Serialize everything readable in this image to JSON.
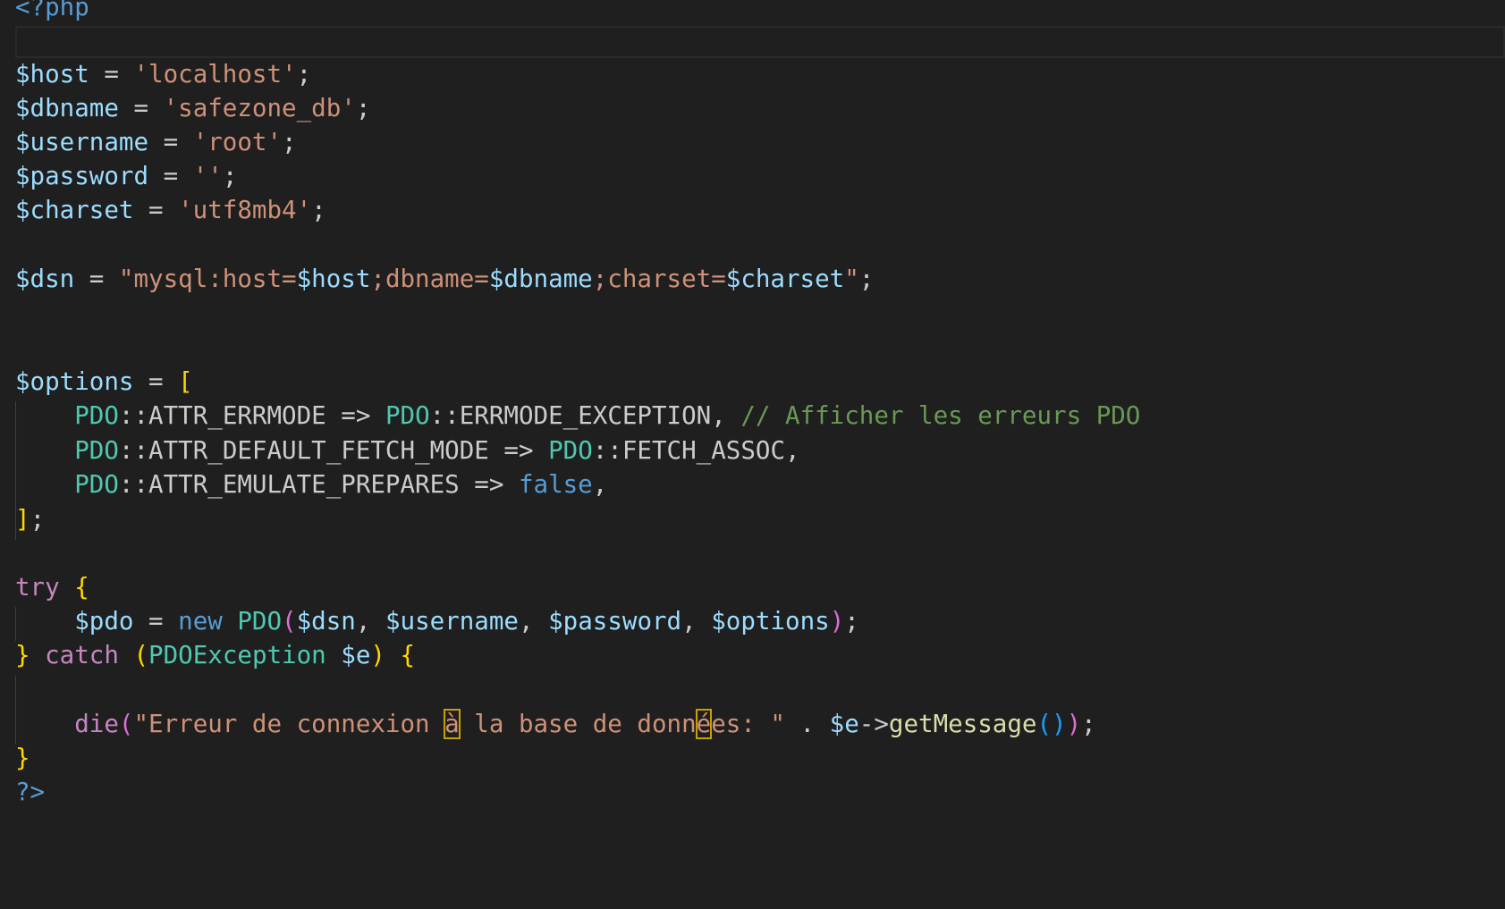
{
  "editor": {
    "lines": {
      "open_tag": "<?php",
      "host_var": "$host",
      "host_val": "'localhost'",
      "dbname_var": "$dbname",
      "dbname_val": "'safezone_db'",
      "username_var": "$username",
      "username_val": "'root'",
      "password_var": "$password",
      "password_val": "''",
      "charset_var": "$charset",
      "charset_val": "'utf8mb4'",
      "dsn_var": "$dsn",
      "dsn_q1": "\"mysql:host=",
      "dsn_host": "$host",
      "dsn_mid1": ";dbname=",
      "dsn_dbname": "$dbname",
      "dsn_mid2": ";charset=",
      "dsn_charset": "$charset",
      "dsn_q2": "\"",
      "options_var": "$options",
      "pdo_cls": "PDO",
      "errmode_attr": "ATTR_ERRMODE",
      "errmode_exc": "ERRMODE_EXCEPTION",
      "errmode_comment": "// Afficher les erreurs PDO",
      "fetch_attr": "ATTR_DEFAULT_FETCH_MODE",
      "fetch_assoc": "FETCH_ASSOC",
      "emulate_attr": "ATTR_EMULATE_PREPARES",
      "false_kw": "false",
      "try_kw": "try",
      "pdo_var": "$pdo",
      "new_kw": "new",
      "dsn_arg": "$dsn",
      "username_arg": "$username",
      "password_arg": "$password",
      "options_arg": "$options",
      "catch_kw": "catch",
      "exception_cls": "PDOException",
      "e_var": "$e",
      "die_fn": "die",
      "die_str_a": "\"Erreur de connexion ",
      "die_str_agrave": "à",
      "die_str_b": " la base de donn",
      "die_str_eacute": "é",
      "die_str_c": "es: \"",
      "get_message": "getMessage",
      "close_tag": "?>"
    }
  }
}
